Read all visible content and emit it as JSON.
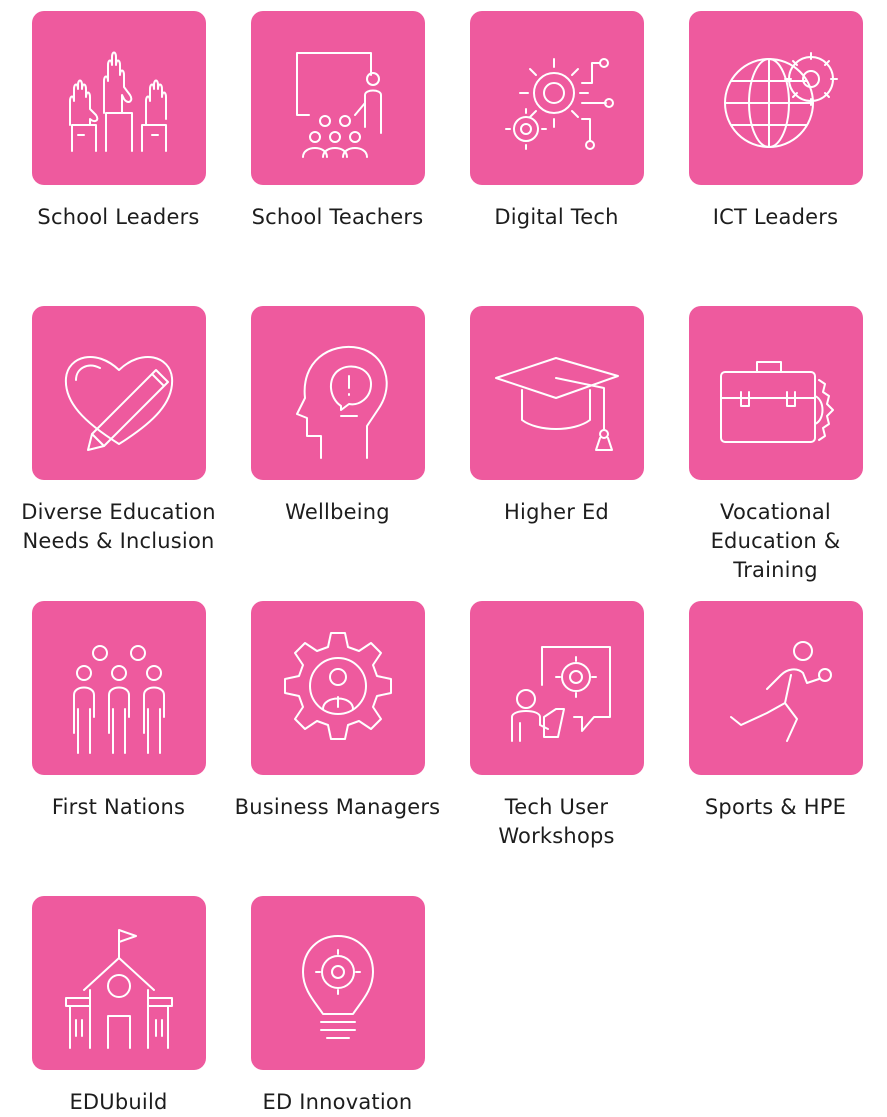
{
  "tile_color": "#ee5a9e",
  "label_color": "#1d1d1d",
  "categories": [
    {
      "label": "School Leaders",
      "icon": "raised-hands-icon"
    },
    {
      "label": "School Teachers",
      "icon": "classroom-teacher-icon"
    },
    {
      "label": "Digital Tech",
      "icon": "gears-circuit-icon"
    },
    {
      "label": "ICT Leaders",
      "icon": "globe-gear-icon"
    },
    {
      "label": "Diverse Education Needs & Inclusion",
      "icon": "heart-pencil-icon"
    },
    {
      "label": "Wellbeing",
      "icon": "head-thought-icon"
    },
    {
      "label": "Higher Ed",
      "icon": "graduation-cap-icon"
    },
    {
      "label": "Vocational Education & Training",
      "icon": "briefcase-gear-icon"
    },
    {
      "label": "First Nations",
      "icon": "people-group-icon"
    },
    {
      "label": "Business Managers",
      "icon": "gear-person-icon"
    },
    {
      "label": "Tech User Workshops",
      "icon": "presenter-gear-icon"
    },
    {
      "label": "Sports & HPE",
      "icon": "runner-icon"
    },
    {
      "label": "EDUbuild",
      "icon": "school-building-icon"
    },
    {
      "label": "ED Innovation",
      "icon": "lightbulb-gear-icon"
    }
  ]
}
